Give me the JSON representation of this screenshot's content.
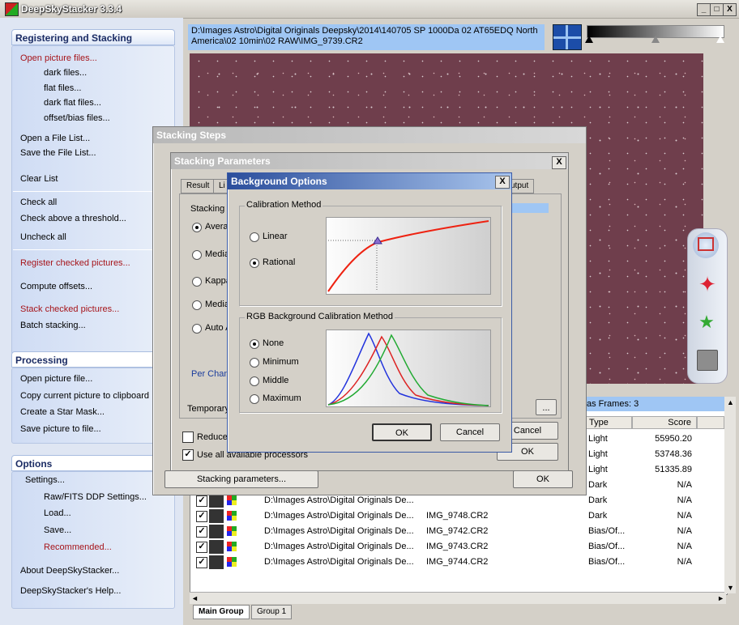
{
  "app": {
    "title": "DeepSkyStacker 3.3.4"
  },
  "window_buttons": {
    "min": "_",
    "max": "□",
    "close": "X"
  },
  "left": {
    "reg": {
      "heading": "Registering and Stacking",
      "open_pictures": "Open picture files...",
      "dark": "dark files...",
      "flat": "flat files...",
      "dark_flat": "dark flat files...",
      "offset_bias": "offset/bias files...",
      "open_list": "Open a File List...",
      "save_list": "Save the File List...",
      "clear": "Clear List",
      "check_all": "Check all",
      "check_above": "Check above a threshold...",
      "uncheck_all": "Uncheck all",
      "register": "Register checked pictures...",
      "compute": "Compute offsets...",
      "stack": "Stack checked pictures...",
      "batch": "Batch stacking..."
    },
    "proc": {
      "heading": "Processing",
      "open": "Open picture file...",
      "copy": "Copy current picture to clipboard",
      "star_mask": "Create a Star Mask...",
      "save": "Save picture to file..."
    },
    "opts": {
      "heading": "Options",
      "settings": "Settings...",
      "raw": "Raw/FITS DDP Settings...",
      "load": "Load...",
      "save": "Save...",
      "recommended": "Recommended...",
      "about": "About DeepSkyStacker...",
      "help": "DeepSkyStacker's Help..."
    }
  },
  "path": "D:\\Images Astro\\Digital Originals Deepsky\\2014\\140705 SP 1000Da 02 AT65EDQ North America\\02 10min\\02 RAW\\IMG_9739.CR2",
  "frames_label": "as Frames: 3",
  "table": {
    "headers": {
      "type": "Type",
      "score": "Score"
    },
    "rows_top": [
      {
        "type": "Light",
        "score": "55950.20"
      },
      {
        "type": "Light",
        "score": "53748.36"
      },
      {
        "type": "Light",
        "score": "51335.89"
      },
      {
        "type": "Dark",
        "score": "N/A"
      }
    ],
    "rows": [
      {
        "path": "D:\\Images Astro\\Digital Originals De...",
        "file": "",
        "type": "Dark",
        "score": "N/A"
      },
      {
        "path": "D:\\Images Astro\\Digital Originals De...",
        "file": "IMG_9748.CR2",
        "type": "Dark",
        "score": "N/A"
      },
      {
        "path": "D:\\Images Astro\\Digital Originals De...",
        "file": "IMG_9742.CR2",
        "type": "Bias/Of...",
        "score": "N/A"
      },
      {
        "path": "D:\\Images Astro\\Digital Originals De...",
        "file": "IMG_9743.CR2",
        "type": "Bias/Of...",
        "score": "N/A"
      },
      {
        "path": "D:\\Images Astro\\Digital Originals De...",
        "file": "IMG_9744.CR2",
        "type": "Bias/Of...",
        "score": "N/A"
      }
    ]
  },
  "tabs": {
    "main": "Main Group",
    "group1": "Group 1"
  },
  "stacking_steps": {
    "title": "Stacking Steps",
    "use_all": "Use all available processors",
    "stacking_params_btn": "Stacking parameters...",
    "ok": "OK"
  },
  "stacking_params": {
    "title": "Stacking Parameters",
    "close": "X",
    "tab_result": "Result",
    "tab_light": "Li",
    "tab_output": "utput",
    "stacking_label": "Stacking",
    "opt_average": "Avera",
    "opt_median": "Media",
    "opt_kappa": "Kappa",
    "opt_median2": "Media",
    "opt_auto": "Auto A",
    "per_channel": "Per Chan",
    "temporary": "Temporary",
    "reduce": "Reduce",
    "browse": "...",
    "cancel": "Cancel",
    "ok": "OK"
  },
  "bg_options": {
    "title": "Background Options",
    "close": "X",
    "calib_legend": "Calibration Method",
    "linear": "Linear",
    "rational": "Rational",
    "rgb_legend": "RGB Background Calibration Method",
    "none": "None",
    "minimum": "Minimum",
    "middle": "Middle",
    "maximum": "Maximum",
    "ok": "OK",
    "cancel": "Cancel"
  },
  "colors": {
    "accent_red": "#a6141a",
    "header_blue": "#1b2c64",
    "path_bg": "#9fc6f4"
  }
}
